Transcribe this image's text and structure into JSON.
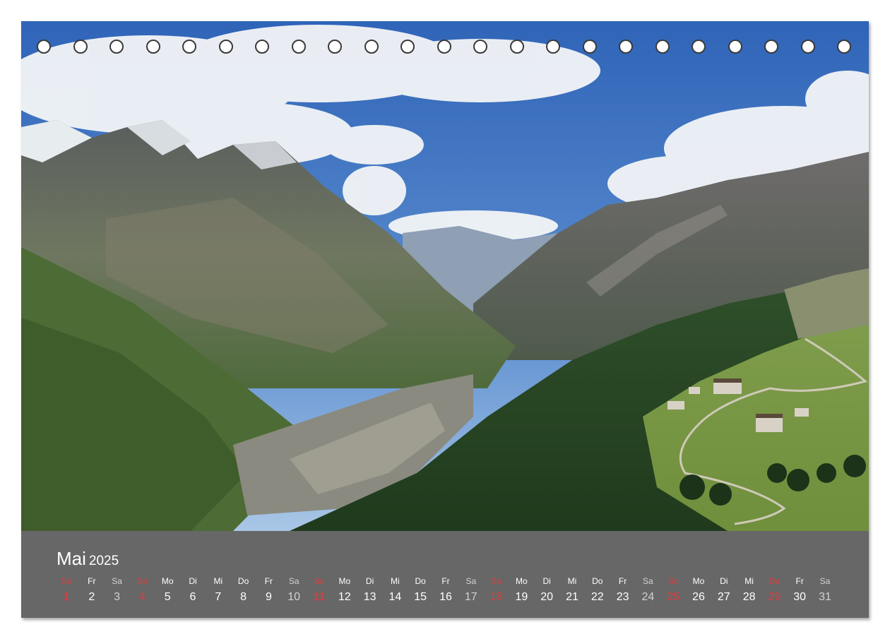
{
  "calendar": {
    "month": "Mai",
    "year": "2025",
    "weekdays": [
      "So",
      "Fr",
      "Sa",
      "So",
      "Mo",
      "Di",
      "Mi",
      "Do",
      "Fr",
      "Sa",
      "So",
      "Mo",
      "Di",
      "Mi",
      "Do",
      "Fr",
      "Sa",
      "So",
      "Mo",
      "Di",
      "Mi",
      "Do",
      "Fr",
      "Sa",
      "So",
      "Mo",
      "Di",
      "Mi",
      "Do",
      "Fr",
      "Sa"
    ],
    "days": [
      "1",
      "2",
      "3",
      "4",
      "5",
      "6",
      "7",
      "8",
      "9",
      "10",
      "11",
      "12",
      "13",
      "14",
      "15",
      "16",
      "17",
      "18",
      "19",
      "20",
      "21",
      "22",
      "23",
      "24",
      "25",
      "26",
      "27",
      "28",
      "29",
      "30",
      "31"
    ],
    "day_types": [
      "sun",
      "week",
      "sat",
      "sun",
      "week",
      "week",
      "week",
      "week",
      "week",
      "sat",
      "sun",
      "week",
      "week",
      "week",
      "week",
      "week",
      "sat",
      "sun",
      "week",
      "week",
      "week",
      "week",
      "week",
      "sat",
      "sun",
      "week",
      "week",
      "week",
      "sun",
      "week",
      "sat"
    ]
  },
  "colors": {
    "band": "#676767",
    "sunday": "#e23c3c",
    "saturday": "#d2d2d2",
    "text": "#ffffff"
  },
  "photo": {
    "icon": "mountain-valley-landscape"
  },
  "binding_holes": {
    "count": 23
  }
}
